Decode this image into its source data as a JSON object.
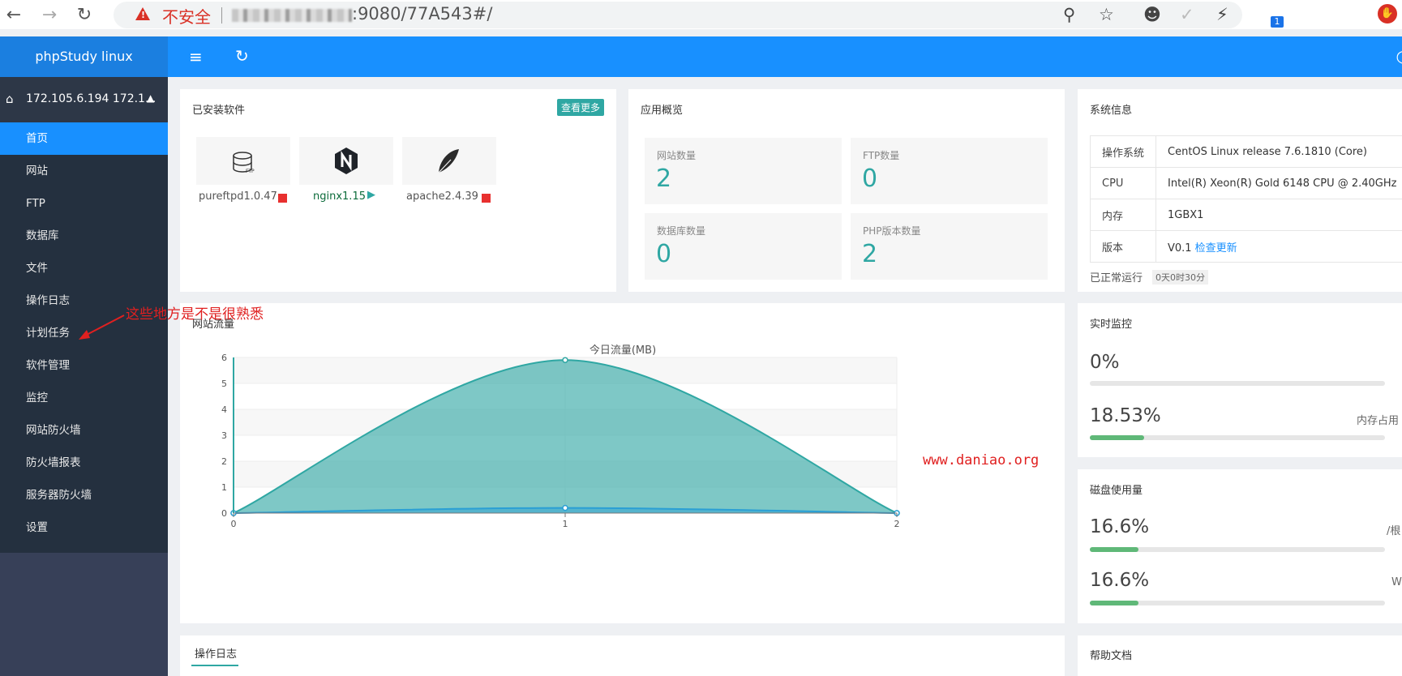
{
  "browser": {
    "insecure_label": "不安全",
    "url": ":9080/77A543#/",
    "extension_badge": "1"
  },
  "app": {
    "brand": "phpStudy linux",
    "host": "172.105.6.194 172.1..."
  },
  "sidebar": {
    "items": [
      {
        "label": "首页",
        "active": true
      },
      {
        "label": "网站"
      },
      {
        "label": "FTP"
      },
      {
        "label": "数据库"
      },
      {
        "label": "文件"
      },
      {
        "label": "操作日志"
      },
      {
        "label": "计划任务"
      },
      {
        "label": "软件管理"
      },
      {
        "label": "监控"
      },
      {
        "label": "网站防火墙"
      },
      {
        "label": "防火墙报表"
      },
      {
        "label": "服务器防火墙"
      },
      {
        "label": "设置"
      }
    ]
  },
  "installed": {
    "title": "已安装软件",
    "more_button": "查看更多",
    "items": [
      {
        "name": "pureftpd1.0.47",
        "status": "stopped",
        "icon": "database-icon"
      },
      {
        "name": "nginx1.15",
        "status": "running",
        "icon": "nginx-icon"
      },
      {
        "name": "apache2.4.39",
        "status": "stopped",
        "icon": "feather-icon"
      }
    ]
  },
  "overview": {
    "title": "应用概览",
    "stats": [
      {
        "label": "网站数量",
        "value": "2"
      },
      {
        "label": "FTP数量",
        "value": "0"
      },
      {
        "label": "数据库数量",
        "value": "0"
      },
      {
        "label": "PHP版本数量",
        "value": "2"
      }
    ]
  },
  "sysinfo": {
    "title": "系统信息",
    "rows": [
      {
        "key": "操作系统",
        "value": "CentOS Linux release 7.6.1810 (Core)"
      },
      {
        "key": "CPU",
        "value": "Intel(R) Xeon(R) Gold 6148 CPU @ 2.40GHz"
      },
      {
        "key": "内存",
        "value": "1GBX1"
      },
      {
        "key": "版本",
        "value": "V0.1",
        "link": "检查更新"
      }
    ],
    "uptime_label": "已正常运行",
    "uptime_value": "0天0时30分"
  },
  "traffic": {
    "title": "网站流量",
    "chart_title": "今日流量(MB)"
  },
  "chart_data": {
    "type": "area",
    "title": "今日流量(MB)",
    "x": [
      0,
      1,
      2
    ],
    "ylim": [
      0,
      6
    ],
    "yticks": [
      0,
      1,
      2,
      3,
      4,
      5,
      6
    ],
    "grid": true,
    "smooth": true,
    "series": [
      {
        "values": [
          0,
          5.9,
          0
        ],
        "color": "#2fa7a3"
      },
      {
        "values": [
          0,
          0.2,
          0
        ],
        "color": "#2b9fd4"
      }
    ]
  },
  "realtime": {
    "title": "实时监控",
    "cpu": {
      "value": "0%",
      "fraction": 0.0
    },
    "mem": {
      "value": "18.53%",
      "fraction": 0.1853,
      "side_label": "内存占用"
    }
  },
  "disk": {
    "title": "磁盘使用量",
    "items": [
      {
        "value": "16.6%",
        "fraction": 0.166,
        "side_label": "/根"
      },
      {
        "value": "16.6%",
        "fraction": 0.166,
        "side_label": "W"
      }
    ]
  },
  "oplog": {
    "tab": "操作日志"
  },
  "help": {
    "title": "帮助文档"
  },
  "annotation": {
    "text": "这些地方是不是很熟悉",
    "color": "#e02020"
  },
  "watermark": {
    "text": "www.daniao.org"
  },
  "colors": {
    "accent": "#1890ff",
    "teal": "#2fa7a3",
    "sidebar": "#24303f",
    "stopped": "#e8302f",
    "meter": "#5fb878"
  }
}
